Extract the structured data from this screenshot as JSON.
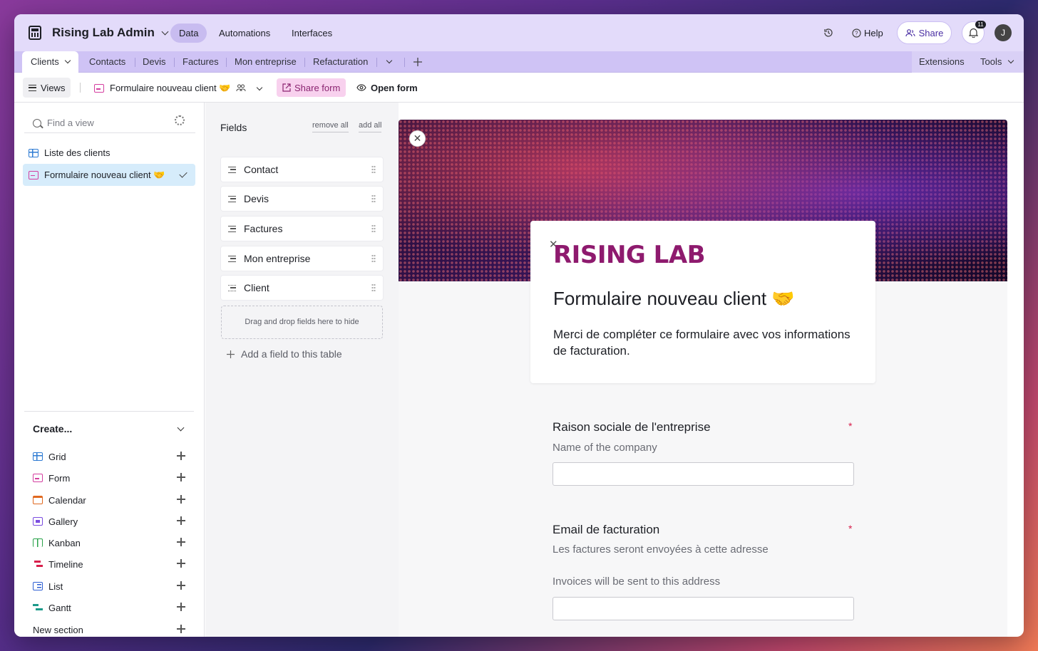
{
  "app": {
    "title": "Rising Lab Admin"
  },
  "nav": {
    "data": "Data",
    "automations": "Automations",
    "interfaces": "Interfaces"
  },
  "topright": {
    "help": "Help",
    "share": "Share",
    "notifications": "11",
    "avatar": "J"
  },
  "tabs": [
    "Clients",
    "Contacts",
    "Devis",
    "Factures",
    "Mon entreprise",
    "Refacturation"
  ],
  "tabbar_right": {
    "extensions": "Extensions",
    "tools": "Tools"
  },
  "viewbar": {
    "views": "Views",
    "current_view": "Formulaire nouveau client 🤝",
    "share_form": "Share form",
    "open_form": "Open form"
  },
  "sidebar": {
    "search_placeholder": "Find a view",
    "views": [
      {
        "label": "Liste des clients",
        "icon": "grid-icon"
      },
      {
        "label": "Formulaire nouveau client 🤝",
        "icon": "form-icon",
        "selected": true
      }
    ],
    "create_label": "Create...",
    "create_items": [
      {
        "label": "Grid",
        "icon": "grid-icon",
        "color": "#2e7bd3"
      },
      {
        "label": "Form",
        "icon": "form-icon",
        "color": "#d43fa0"
      },
      {
        "label": "Calendar",
        "icon": "calendar-icon",
        "color": "#e0681f"
      },
      {
        "label": "Gallery",
        "icon": "gallery-icon",
        "color": "#7b4de0"
      },
      {
        "label": "Kanban",
        "icon": "kanban-icon",
        "color": "#2aa34a"
      },
      {
        "label": "Timeline",
        "icon": "timeline-icon",
        "color": "#d8204c"
      },
      {
        "label": "List",
        "icon": "list-icon",
        "color": "#2e5fd3"
      },
      {
        "label": "Gantt",
        "icon": "gantt-icon",
        "color": "#1c9a8a"
      },
      {
        "label": "New section",
        "icon": "",
        "color": ""
      }
    ]
  },
  "fields_panel": {
    "title": "Fields",
    "remove_all": "remove all",
    "add_all": "add all",
    "fields": [
      "Contact",
      "Devis",
      "Factures",
      "Mon entreprise",
      "Client"
    ],
    "dropzone": "Drag and drop fields here to hide",
    "add_field": "Add a field to this table"
  },
  "form": {
    "logo_text": "RISING LAB",
    "title": "Formulaire nouveau client 🤝",
    "description": "Merci de compléter ce formulaire avec vos informations de facturation.",
    "questions": [
      {
        "label": "Raison sociale de l'entreprise",
        "help": "Name of the company",
        "required_mark": "*"
      },
      {
        "label": "Email de facturation",
        "help": "Les factures seront envoyées à cette adresse",
        "help2": "Invoices will be sent to this address",
        "required_mark": "*"
      }
    ]
  },
  "colors": {
    "topbar": "#e3dbfa",
    "accent": "#4a2fa3",
    "brand": "#8e1a6e",
    "required": "#d8204c"
  }
}
